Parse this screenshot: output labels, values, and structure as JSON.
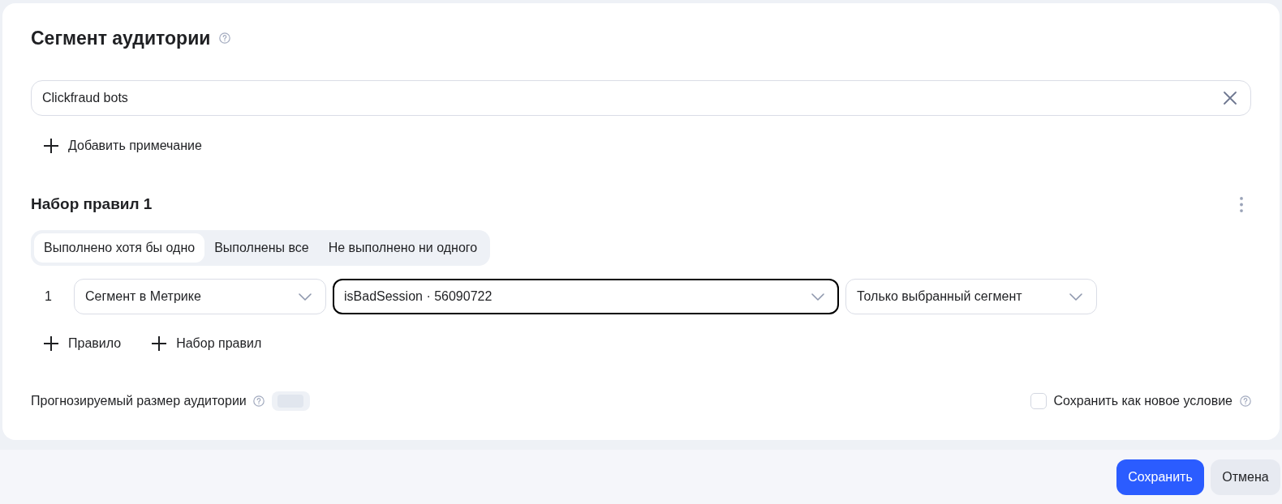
{
  "title": {
    "text": "Сегмент аудитории"
  },
  "name_field": {
    "value": "Clickfraud bots"
  },
  "add_note": {
    "label": "Добавить примечание"
  },
  "rule_sets": [
    {
      "title": "Набор правил 1",
      "modes": [
        {
          "label": "Выполнено хотя бы одно",
          "selected": true
        },
        {
          "label": "Выполнены все",
          "selected": false
        },
        {
          "label": "Не выполнено ни одного",
          "selected": false
        }
      ],
      "rules": [
        {
          "number": "1",
          "dropdowns": [
            {
              "value": "Сегмент в Метрике",
              "focused": false
            },
            {
              "value": "isBadSession · 56090722",
              "focused": true
            },
            {
              "value": "Только выбранный сегмент",
              "focused": false
            }
          ]
        }
      ]
    }
  ],
  "add_actions": [
    {
      "label": "Правило"
    },
    {
      "label": "Набор правил"
    }
  ],
  "forecast": {
    "label": "Прогнозируемый размер аудитории",
    "loading": true
  },
  "save_as_new": {
    "label": "Сохранить как новое условие",
    "checked": false
  },
  "buttons": [
    {
      "label": "Сохранить",
      "kind": "primary"
    },
    {
      "label": "Отмена",
      "kind": "secondary"
    }
  ]
}
